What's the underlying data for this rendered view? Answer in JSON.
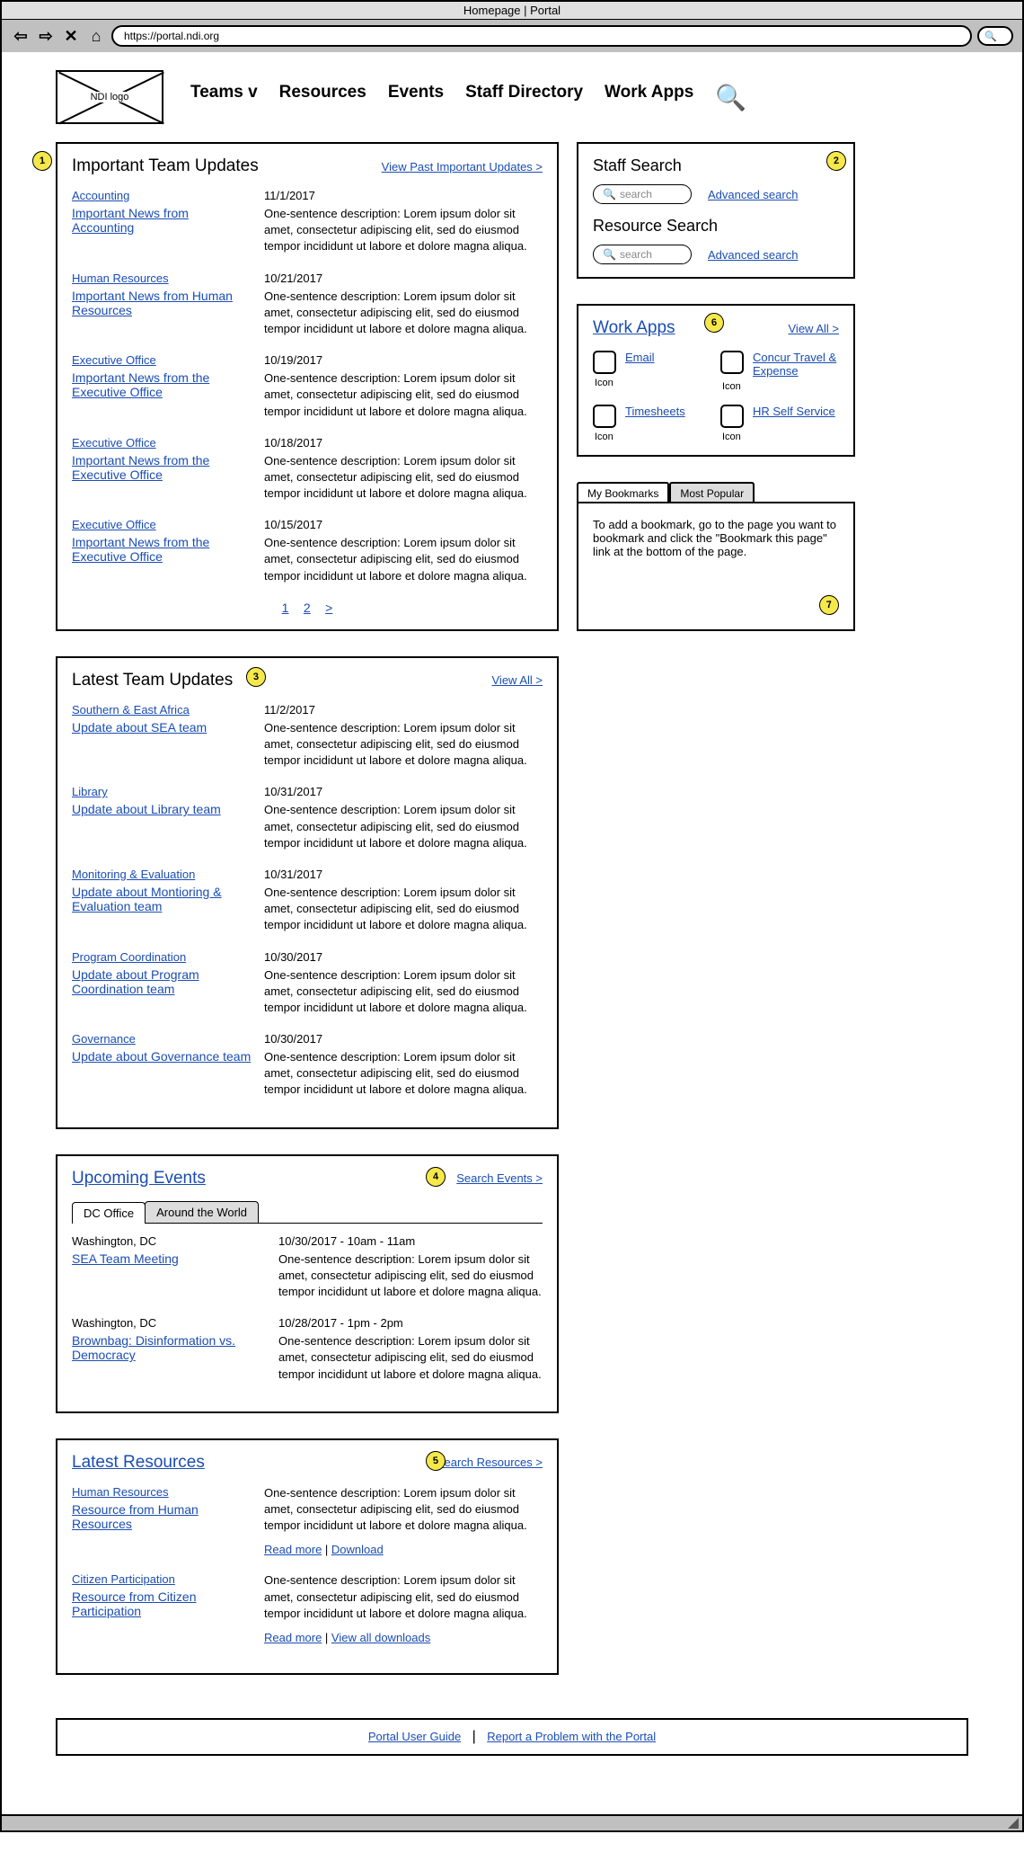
{
  "browser": {
    "title": "Homepage | Portal",
    "url": "https://portal.ndi.org"
  },
  "logo": "NDI logo",
  "nav": {
    "teams": "Teams v",
    "resources": "Resources",
    "events": "Events",
    "staff": "Staff Directory",
    "apps": "Work Apps"
  },
  "badges": {
    "b1": "1",
    "b2": "2",
    "b3": "3",
    "b4": "4",
    "b5": "5",
    "b6": "6",
    "b7": "7"
  },
  "important": {
    "title": "Important Team Updates",
    "link": "View Past Important Updates >",
    "items": [
      {
        "cat": "Accounting",
        "title": "Important News from Accounting",
        "date": "11/1/2017",
        "desc": "One-sentence description: Lorem ipsum dolor sit amet, consectetur adipiscing elit, sed do eiusmod tempor incididunt ut labore et dolore magna aliqua."
      },
      {
        "cat": "Human Resources",
        "title": "Important News from Human Resources",
        "date": "10/21/2017",
        "desc": "One-sentence description: Lorem ipsum dolor sit amet, consectetur adipiscing elit, sed do eiusmod tempor incididunt ut labore et dolore magna aliqua."
      },
      {
        "cat": "Executive Office",
        "title": "Important News from the Executive Office",
        "date": "10/19/2017",
        "desc": "One-sentence description: Lorem ipsum dolor sit amet, consectetur adipiscing elit, sed do eiusmod tempor incididunt ut labore et dolore magna aliqua."
      },
      {
        "cat": "Executive Office",
        "title": "Important News from the Executive Office",
        "date": "10/18/2017",
        "desc": "One-sentence description: Lorem ipsum dolor sit amet, consectetur adipiscing elit, sed do eiusmod tempor incididunt ut labore et dolore magna aliqua."
      },
      {
        "cat": "Executive Office",
        "title": "Important News from the Executive Office",
        "date": "10/15/2017",
        "desc": "One-sentence description: Lorem ipsum dolor sit amet, consectetur adipiscing elit, sed do eiusmod tempor incididunt ut labore et dolore magna aliqua."
      }
    ],
    "page1": "1",
    "page2": "2",
    "pagenext": ">"
  },
  "latest": {
    "title": "Latest Team Updates",
    "link": "View All >",
    "items": [
      {
        "cat": "Southern & East Africa",
        "title": "Update about SEA team",
        "date": "11/2/2017",
        "desc": "One-sentence description: Lorem ipsum dolor sit amet, consectetur adipiscing elit, sed do eiusmod tempor incididunt ut labore et dolore magna aliqua."
      },
      {
        "cat": "Library",
        "title": "Update about Library team",
        "date": "10/31/2017",
        "desc": "One-sentence description: Lorem ipsum dolor sit amet, consectetur adipiscing elit, sed do eiusmod tempor incididunt ut labore et dolore magna aliqua."
      },
      {
        "cat": "Monitoring & Evaluation",
        "title": "Update about Montioring & Evaluation team",
        "date": "10/31/2017",
        "desc": "One-sentence description: Lorem ipsum dolor sit amet, consectetur adipiscing elit, sed do eiusmod tempor incididunt ut labore et dolore magna aliqua."
      },
      {
        "cat": "Program Coordination",
        "title": "Update about Program Coordination team",
        "date": "10/30/2017",
        "desc": "One-sentence description: Lorem ipsum dolor sit amet, consectetur adipiscing elit, sed do eiusmod tempor incididunt ut labore et dolore magna aliqua."
      },
      {
        "cat": "Governance",
        "title": "Update about Governance team",
        "date": "10/30/2017",
        "desc": "One-sentence description: Lorem ipsum dolor sit amet, consectetur adipiscing elit, sed do eiusmod tempor incididunt ut labore et dolore magna aliqua."
      }
    ]
  },
  "events": {
    "title": "Upcoming Events",
    "link": "Search Events >",
    "tab1": "DC Office",
    "tab2": "Around the World",
    "items": [
      {
        "loc": "Washington, DC",
        "title": "SEA Team Meeting",
        "date": "10/30/2017 - 10am - 11am",
        "desc": "One-sentence description: Lorem ipsum dolor sit amet, consectetur adipiscing elit, sed do eiusmod tempor incididunt ut labore et dolore magna aliqua."
      },
      {
        "loc": "Washington, DC",
        "title": "Brownbag: Disinformation vs. Democracy",
        "date": "10/28/2017 - 1pm - 2pm",
        "desc": "One-sentence description: Lorem ipsum dolor sit amet, consectetur adipiscing elit, sed do eiusmod tempor incididunt ut labore et dolore magna aliqua."
      }
    ]
  },
  "resources": {
    "title": "Latest Resources",
    "link": "Search Resources >",
    "items": [
      {
        "cat": "Human Resources",
        "title": "Resource from Human Resources",
        "desc": "One-sentence description: Lorem ipsum dolor sit amet, consectetur adipiscing elit, sed do eiusmod tempor incididunt ut labore et dolore magna aliqua.",
        "a1": "Read more",
        "a2": "Download"
      },
      {
        "cat": "Citizen Participation",
        "title": "Resource from Citizen Participation",
        "desc": "One-sentence description: Lorem ipsum dolor sit amet, consectetur adipiscing elit, sed do eiusmod tempor incididunt ut labore et dolore magna aliqua.",
        "a1": "Read more",
        "a2": "View all downloads"
      }
    ]
  },
  "search": {
    "staff_title": "Staff Search",
    "resource_title": "Resource Search",
    "placeholder": "search",
    "adv": "Advanced search"
  },
  "apps": {
    "title": "Work Apps",
    "link": "View All >",
    "icon_label": "Icon",
    "items": [
      {
        "label": "Email"
      },
      {
        "label": "Concur Travel & Expense"
      },
      {
        "label": "Timesheets"
      },
      {
        "label": "HR Self Service"
      }
    ]
  },
  "bookmarks": {
    "tab1": "My Bookmarks",
    "tab2": "Most Popular",
    "body": "To add a bookmark, go to the page you want to bookmark and click the \"Bookmark this page\" link at the bottom of the page."
  },
  "footer": {
    "link1": "Portal User Guide",
    "link2": "Report a Problem with the Portal"
  }
}
